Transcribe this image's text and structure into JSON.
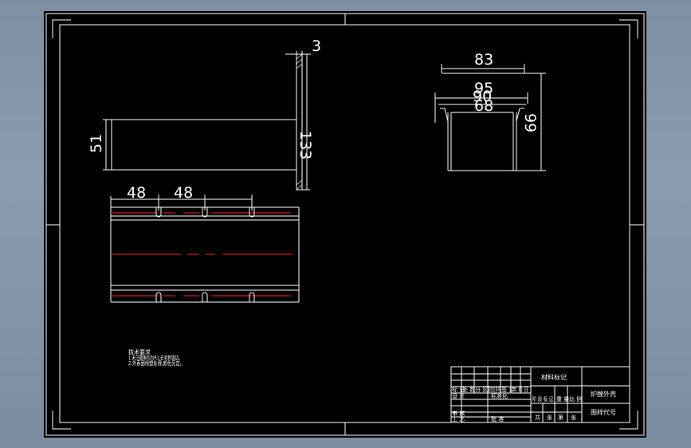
{
  "drawing": {
    "dimensions": {
      "front_thickness": "3",
      "front_height": "133",
      "front_left_height": "51",
      "top_width": "83",
      "top_inner_1": "95",
      "top_inner_2": "90",
      "top_inner_3": "68",
      "top_height": "99",
      "bottom_spacing_1": "48",
      "bottom_spacing_2": "48"
    },
    "notes": {
      "line1": "技术要求",
      "line2": "1.未注圆角均为R1,去毛刺锐边。",
      "line3": "2.外表面喷塑处理,颜色另定。"
    },
    "title_block": {
      "material_mark": "材料标记",
      "part_name": "炉膛外壳",
      "drawing_code": "图样代号",
      "row_labels": [
        "标 记",
        "设 计",
        "审 核",
        "工 艺"
      ],
      "column_labels": [
        "处 数",
        "分 区",
        "更改文件号",
        "签 名",
        "年 月 日"
      ],
      "standardization": "标准化",
      "approve": "批 准",
      "stage_labels": [
        "阶 段 标 记",
        "重 量",
        "比 例"
      ],
      "sheet_labels": [
        "共",
        "张",
        "第",
        "张"
      ]
    }
  }
}
